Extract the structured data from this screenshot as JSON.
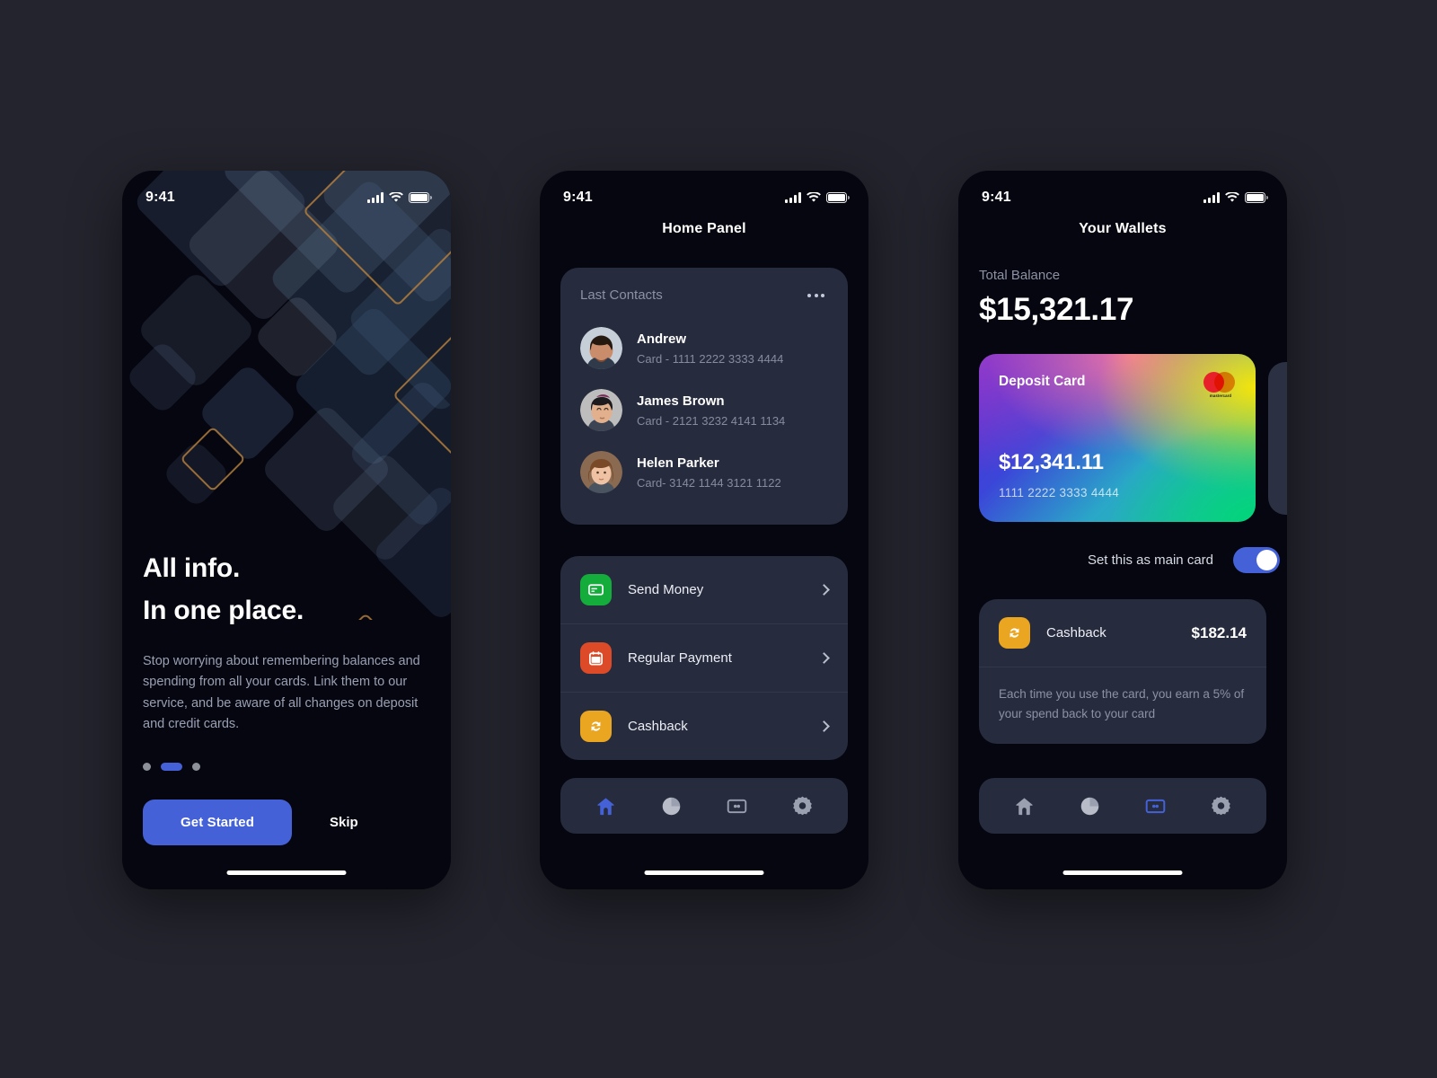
{
  "status_bar": {
    "time": "9:41",
    "signal_icon": "signal-bars-icon",
    "wifi_icon": "wifi-icon",
    "battery_icon": "battery-icon"
  },
  "onboarding": {
    "headline_line1": "All info.",
    "headline_line2": "In one place.",
    "body": "Stop worrying about remembering balances and spending from all your cards. Link them to our service, and be aware of all changes on deposit and credit cards.",
    "pagination": {
      "total": 3,
      "active_index": 1
    },
    "primary_button": "Get Started",
    "skip_button": "Skip",
    "accent_color": "#4561d8"
  },
  "home_panel": {
    "title": "Home Panel",
    "contacts": {
      "title": "Last Contacts",
      "menu_icon": "more-options-icon",
      "items": [
        {
          "name": "Andrew",
          "card": "Card - 1111 2222 3333 4444"
        },
        {
          "name": "James Brown",
          "card": "Card - 2121 3232 4141 1134"
        },
        {
          "name": "Helen Parker",
          "card": "Card- 3142 1144 3121 1122"
        }
      ]
    },
    "actions": [
      {
        "label": "Send Money",
        "icon": "credit-card-icon",
        "color": "#14ad3c"
      },
      {
        "label": "Regular Payment",
        "icon": "calendar-icon",
        "color": "#dd4a28"
      },
      {
        "label": "Cashback",
        "icon": "refresh-icon",
        "color": "#eaa620"
      }
    ]
  },
  "wallets": {
    "title": "Your Wallets",
    "total_balance_label": "Total Balance",
    "total_balance": "$15,321.17",
    "card": {
      "title": "Deposit Card",
      "amount": "$12,341.11",
      "number": "1111 2222 3333 4444",
      "brand": "mastercard",
      "brand_word": "mastercard"
    },
    "main_card_toggle": {
      "label": "Set this as main card",
      "enabled": true
    },
    "cashback": {
      "label": "Cashback",
      "amount": "$182.14",
      "icon": "refresh-icon",
      "description": "Each time you use the card, you earn a 5% of your spend back to your card"
    }
  },
  "nav": {
    "items": [
      {
        "icon": "home-icon",
        "name": "home"
      },
      {
        "icon": "pie-chart-icon",
        "name": "statistics"
      },
      {
        "icon": "wallet-icon",
        "name": "wallet"
      },
      {
        "icon": "gear-icon",
        "name": "settings"
      }
    ],
    "active_home_panel": 0,
    "active_wallets": 2,
    "active_color": "#4561d8",
    "inactive_color": "#9ba0b0"
  }
}
